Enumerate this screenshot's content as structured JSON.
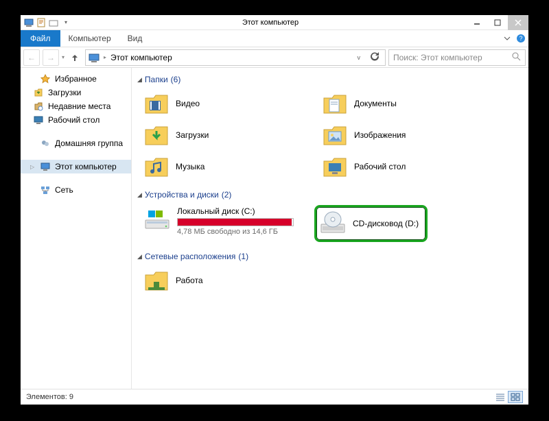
{
  "window": {
    "title": "Этот компьютер"
  },
  "menu": {
    "file": "Файл",
    "computer": "Компьютер",
    "view": "Вид"
  },
  "nav": {
    "breadcrumb_root": "Этот компьютер",
    "search_placeholder": "Поиск: Этот компьютер"
  },
  "sidebar": {
    "favorites": {
      "label": "Избранное",
      "items": [
        "Загрузки",
        "Недавние места",
        "Рабочий стол"
      ]
    },
    "homegroup": "Домашняя группа",
    "thispc": "Этот компьютер",
    "network": "Сеть"
  },
  "sections": {
    "folders": {
      "title": "Папки",
      "count": 6,
      "items": [
        "Видео",
        "Документы",
        "Загрузки",
        "Изображения",
        "Музыка",
        "Рабочий стол"
      ]
    },
    "drives": {
      "title": "Устройства и диски",
      "count": 2,
      "local": {
        "name": "Локальный диск (C:)",
        "free_text": "4,78 МБ свободно из 14,6 ГБ",
        "fill_percent": 99
      },
      "cd": {
        "name": "CD-дисковод (D:)"
      }
    },
    "netloc": {
      "title": "Сетевые расположения",
      "count": 1,
      "items": [
        "Работа"
      ]
    }
  },
  "status": {
    "items_label": "Элементов:",
    "count": 9
  }
}
